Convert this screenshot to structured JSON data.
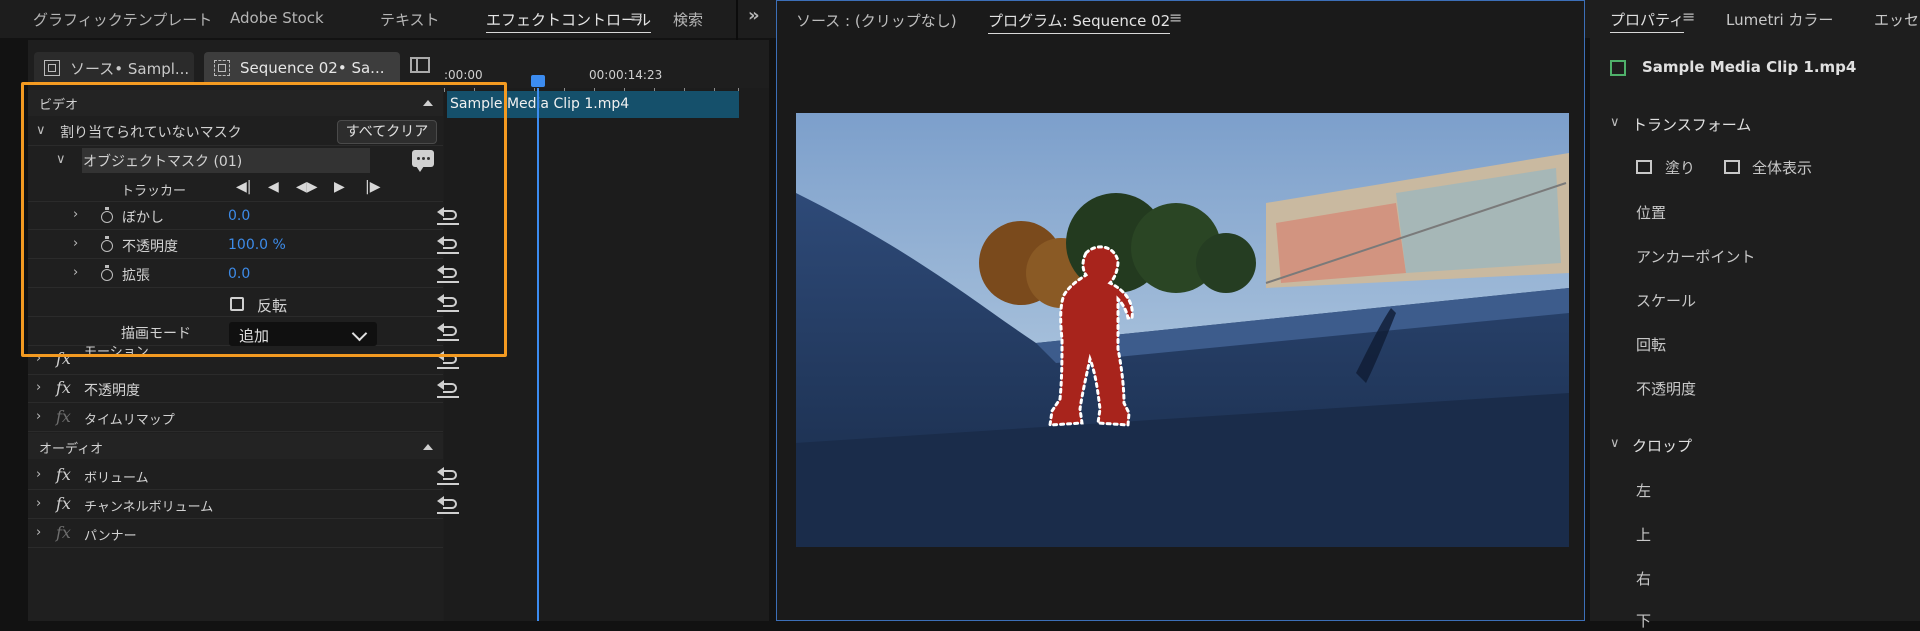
{
  "top_tabs": {
    "graphics_templates": "グラフィックテンプレート",
    "adobe_stock": "Adobe Stock",
    "text": "テキスト",
    "effect_controls": "エフェクトコントロール",
    "search": "検索",
    "overflow": "»"
  },
  "effect_panel": {
    "source_tab": "ソース• Sampl...",
    "sequence_tab": "Sequence 02• Sa...",
    "video_section": "ビデオ",
    "unassigned_masks": "割り当てられていないマスク",
    "clear_all": "すべてクリア",
    "object_mask": "オブジェクトマスク (01)",
    "tracker": "トラッカー",
    "feather_label": "ぼかし",
    "feather_value": "0.0",
    "opacity_label": "不透明度",
    "opacity_value": "100.0 %",
    "expansion_label": "拡張",
    "expansion_value": "0.0",
    "invert_label": "反転",
    "blend_mode_label": "描画モード",
    "blend_mode_value": "追加",
    "motion_partial": "モーション",
    "fx_opacity": "不透明度",
    "time_remap": "タイムリマップ",
    "audio_section": "オーディオ",
    "volume": "ボリューム",
    "channel_volume": "チャンネルボリューム",
    "panner": "パンナー"
  },
  "timeline": {
    "start_tc": ":00:00",
    "mid_tc": "00:00:14:23",
    "clip_name": "Sample Media Clip 1.mp4"
  },
  "monitor": {
    "source_title": "ソース : (クリップなし)",
    "program_title": "プログラム: Sequence 02"
  },
  "properties": {
    "tab_properties": "プロパティ",
    "tab_lumetri": "Lumetri カラー",
    "tab_essential": "エッセン",
    "clip_name": "Sample Media Clip 1.mp4",
    "transform": "トランスフォーム",
    "fill": "塗り",
    "fit": "全体表示",
    "position": "位置",
    "anchor_point": "アンカーポイント",
    "scale": "スケール",
    "rotation": "回転",
    "opacity": "不透明度",
    "crop": "クロップ",
    "left": "左",
    "top": "上",
    "right": "右",
    "bottom_partial": "下"
  },
  "colors": {
    "accent_blue": "#3c8cf0",
    "highlight_orange": "#f39a21",
    "clip_bar": "#15506b",
    "mask_red": "#a8241c"
  }
}
